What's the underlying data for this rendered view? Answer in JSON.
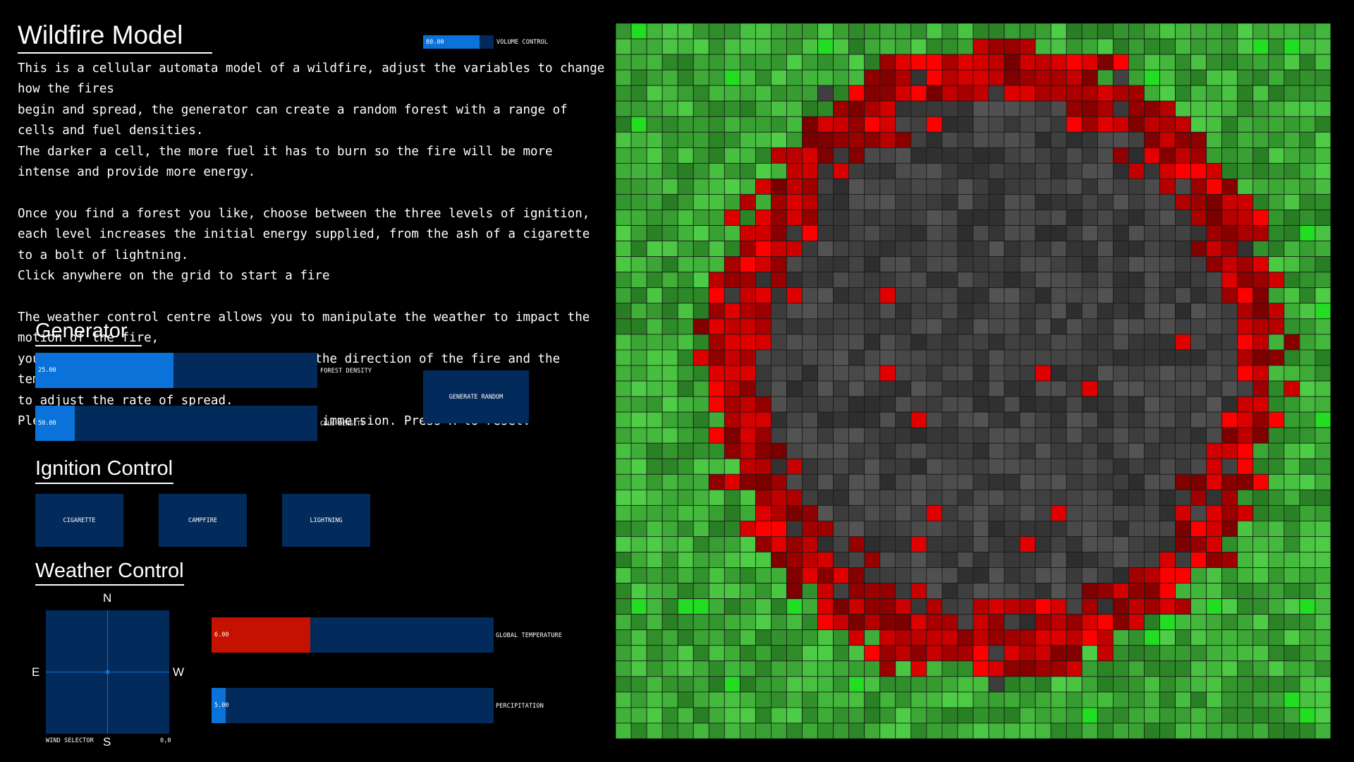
{
  "app": {
    "title": "Wildfire Model"
  },
  "description": "This is a cellular automata model of a wildfire, adjust the variables to change how the fires\nbegin and spread, the generator can create a random forest with a range of cells and fuel densities.\nThe darker a cell, the more fuel it has to burn so the fire will be more intense and provide more energy.\n\nOnce you find a forest you like, choose between the three levels of ignition,\neach level increases the initial energy supplied, from the ash of a cigarette to a bolt of lightning.\nClick anywhere on the grid to start a fire\n\nThe weather control centre allows you to manipulate the weather to impact the motion of the fire,\nyou can adjust the wind vector to alter the direction of the fire and the temperature or percipitation\nto adjust the rate of spread.\nPlease play around with sounds for added immersion. Press R to reset.",
  "volume": {
    "value_text": "80.00",
    "value": 0.8,
    "label": "VOLUME CONTROL"
  },
  "generator": {
    "heading": "Generator",
    "forest_density": {
      "value_text": "25.00",
      "value": 0.49,
      "label": "FOREST DENSITY"
    },
    "cell_density": {
      "value_text": "50.00",
      "value": 0.14,
      "label": "CELL DENSITY"
    },
    "generate_label": "GENERATE RANDOM"
  },
  "ignition": {
    "heading": "Ignition Control",
    "buttons": [
      "CIGARETTE",
      "CAMPFIRE",
      "LIGHTNING"
    ]
  },
  "weather": {
    "heading": "Weather Control",
    "compass": {
      "n": "N",
      "s": "S",
      "e": "E",
      "w": "W"
    },
    "wind_label": "WIND SELECTOR",
    "wind_value": "0,0",
    "temperature": {
      "value_text": "6.00",
      "value": 0.35,
      "label": "GLOBAL TEMPERATURE"
    },
    "precipitation": {
      "value_text": "5.00",
      "value": 0.05,
      "label": "PERCIPITATION"
    }
  },
  "colors": {
    "background": "#000000",
    "slider_track": "#022a5a",
    "slider_fill": "#0a72d8",
    "temperature_fill": "#c51200",
    "tree": "#4a9a44",
    "fire": "#c00000",
    "ash": "#3a3a3a"
  },
  "grid": {
    "rows": 46,
    "cols": 46,
    "fire_ring_center": [
      21,
      24
    ],
    "fire_ring_radius": [
      20,
      18
    ]
  }
}
